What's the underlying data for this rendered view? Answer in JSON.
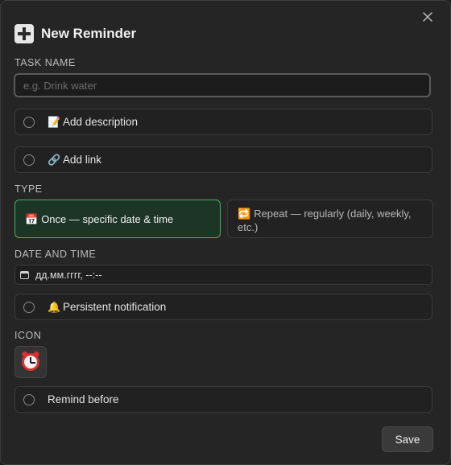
{
  "dialog": {
    "title": "New Reminder",
    "close_symbol": "×",
    "title_icon": "plus-icon"
  },
  "task_name": {
    "label": "TASK NAME",
    "placeholder": "e.g. Drink water",
    "value": ""
  },
  "options": {
    "description": {
      "icon": "📝",
      "label": "Add description"
    },
    "link": {
      "icon": "🔗",
      "label": "Add link"
    },
    "persistent": {
      "icon": "🔔",
      "label": "Persistent notification"
    },
    "remind_before": {
      "label": "Remind before"
    }
  },
  "type": {
    "label": "TYPE",
    "once": {
      "icon": "📅",
      "label": "Once — specific date & time",
      "selected": true
    },
    "repeat": {
      "icon": "🔁",
      "label": "Repeat — regularly (daily, weekly, etc.)",
      "selected": false
    }
  },
  "date_time": {
    "label": "DATE AND TIME",
    "value": "дд.мм.гггг, --:--"
  },
  "icon_section": {
    "label": "ICON",
    "selected_icon": "alarm-clock-icon"
  },
  "save_label": "Save",
  "colors": {
    "accent": "#3fb55c",
    "background": "#252525"
  }
}
